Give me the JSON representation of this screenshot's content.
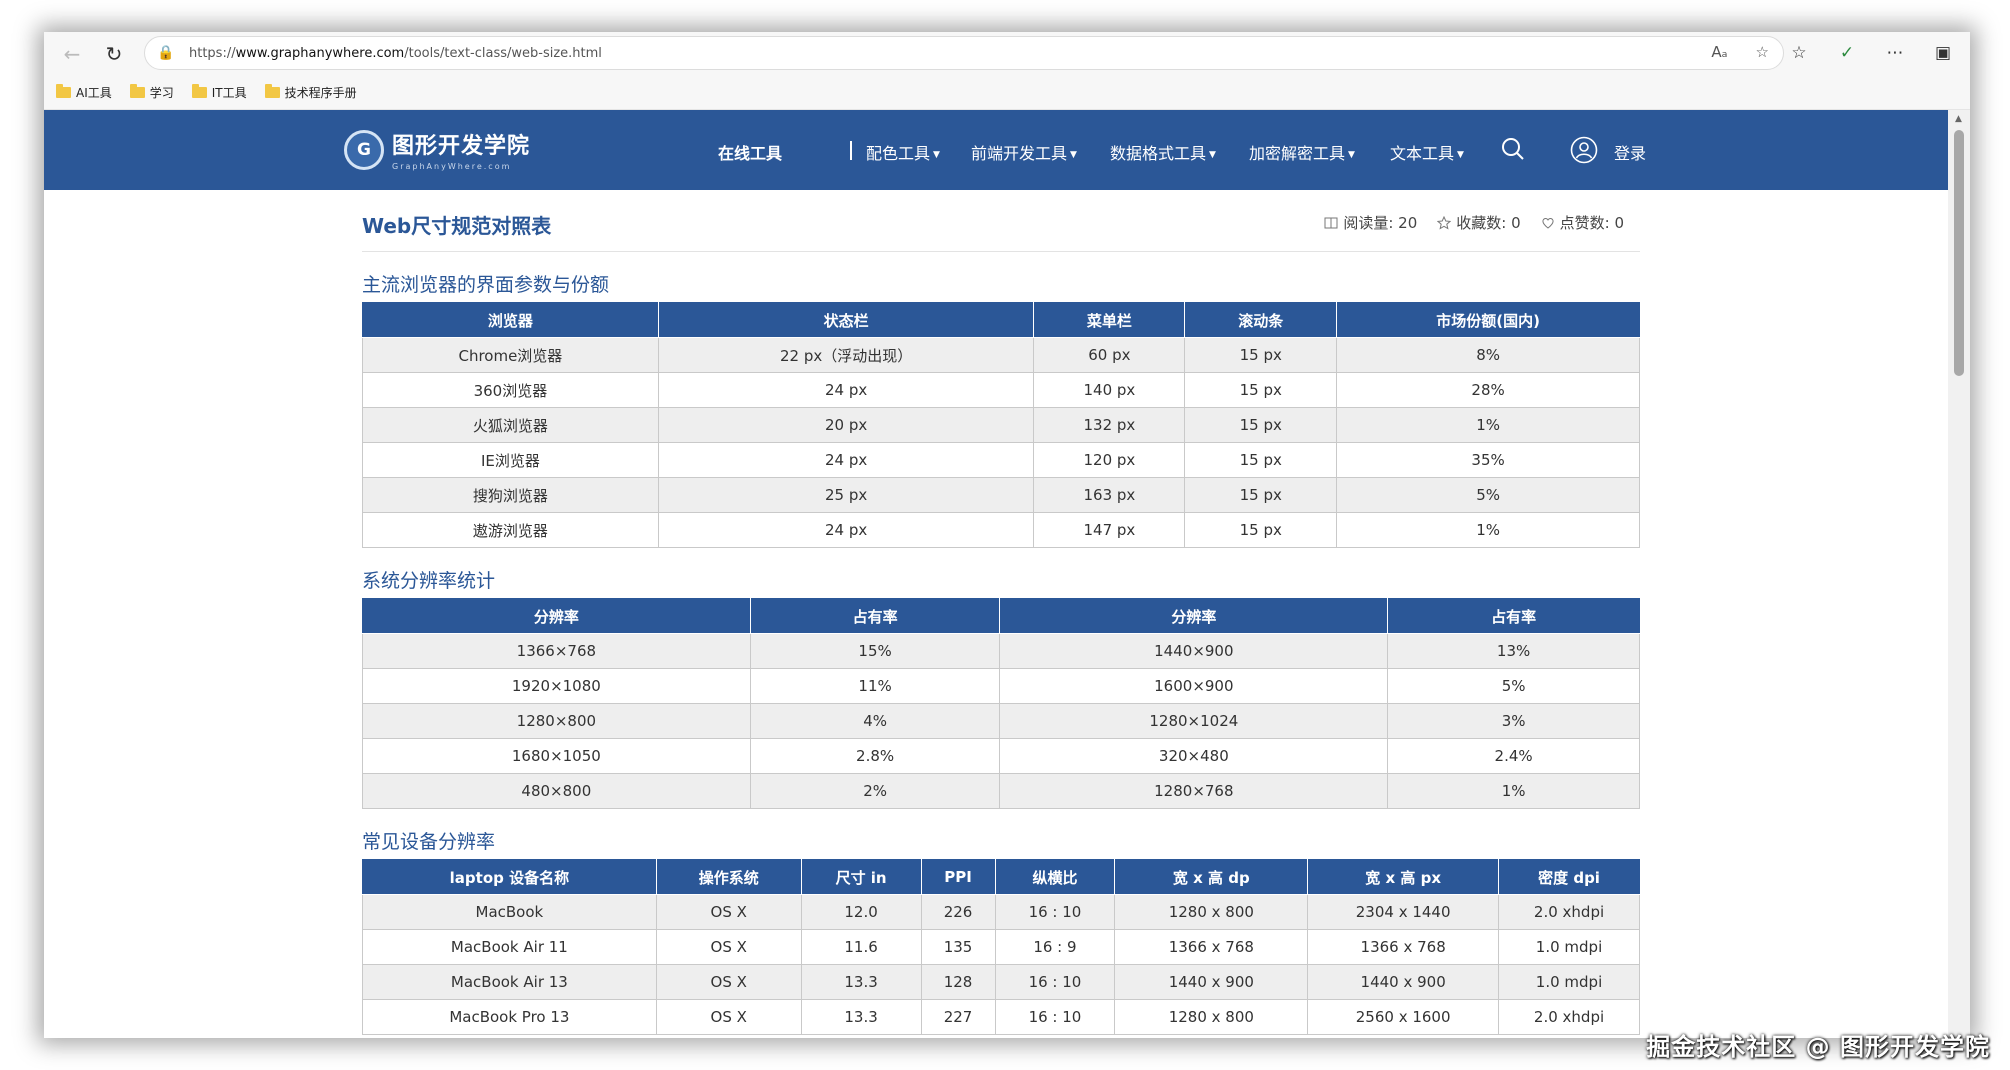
{
  "browser": {
    "url_prefix": "https://",
    "url_host": "www.graphanywhere.com",
    "url_path": "/tools/text-class/web-size.html",
    "read_aloud": "Aₐ",
    "bookmarks": [
      "AI工具",
      "学习",
      "IT工具",
      "技术程序手册"
    ]
  },
  "site": {
    "logo_name": "图形开发学院",
    "logo_sub": "GraphAnyWhere.com",
    "logo_mark": "G",
    "nav": {
      "online_tools": "在线工具",
      "color_tools": "配色工具",
      "frontend_tools": "前端开发工具",
      "data_format_tools": "数据格式工具",
      "crypto_tools": "加密解密工具",
      "text_tools": "文本工具"
    },
    "login": "登录"
  },
  "article": {
    "title": "Web尺寸规范对照表",
    "reads_label": "阅读量: 20",
    "favorites_label": "收藏数: 0",
    "likes_label": "点赞数: 0"
  },
  "sections": {
    "browsers": {
      "title": "主流浏览器的界面参数与份额",
      "headers": [
        "浏览器",
        "状态栏",
        "菜单栏",
        "滚动条",
        "市场份额(国内)"
      ],
      "rows": [
        [
          "Chrome浏览器",
          "22 px（浮动出现）",
          "60 px",
          "15 px",
          "8%"
        ],
        [
          "360浏览器",
          "24 px",
          "140 px",
          "15 px",
          "28%"
        ],
        [
          "火狐浏览器",
          "20 px",
          "132 px",
          "15 px",
          "1%"
        ],
        [
          "IE浏览器",
          "24 px",
          "120 px",
          "15 px",
          "35%"
        ],
        [
          "搜狗浏览器",
          "25 px",
          "163 px",
          "15 px",
          "5%"
        ],
        [
          "遨游浏览器",
          "24 px",
          "147 px",
          "15 px",
          "1%"
        ]
      ]
    },
    "resolution": {
      "title": "系统分辨率统计",
      "headers": [
        "分辨率",
        "占有率",
        "分辨率",
        "占有率"
      ],
      "rows": [
        [
          "1366×768",
          "15%",
          "1440×900",
          "13%"
        ],
        [
          "1920×1080",
          "11%",
          "1600×900",
          "5%"
        ],
        [
          "1280×800",
          "4%",
          "1280×1024",
          "3%"
        ],
        [
          "1680×1050",
          "2.8%",
          "320×480",
          "2.4%"
        ],
        [
          "480×800",
          "2%",
          "1280×768",
          "1%"
        ]
      ]
    },
    "devices": {
      "title": "常见设备分辨率",
      "headers": [
        "laptop 设备名称",
        "操作系统",
        "尺寸 in",
        "PPI",
        "纵横比",
        "宽 x 高 dp",
        "宽 x 高 px",
        "密度 dpi"
      ],
      "rows": [
        [
          "MacBook",
          "OS X",
          "12.0",
          "226",
          "16 : 10",
          "1280 x 800",
          "2304 x 1440",
          "2.0 xhdpi"
        ],
        [
          "MacBook Air 11",
          "OS X",
          "11.6",
          "135",
          "16 : 9",
          "1366 x 768",
          "1366 x 768",
          "1.0 mdpi"
        ],
        [
          "MacBook Air 13",
          "OS X",
          "13.3",
          "128",
          "16 : 10",
          "1440 x 900",
          "1440 x 900",
          "1.0 mdpi"
        ],
        [
          "MacBook Pro 13",
          "OS X",
          "13.3",
          "227",
          "16 : 10",
          "1280 x 800",
          "2560 x 1600",
          "2.0 xhdpi"
        ]
      ]
    }
  },
  "watermark": "掘金技术社区 @ 图形开发学院",
  "colors": {
    "brand": "#2b5797",
    "row_alt": "#eeeeee"
  }
}
